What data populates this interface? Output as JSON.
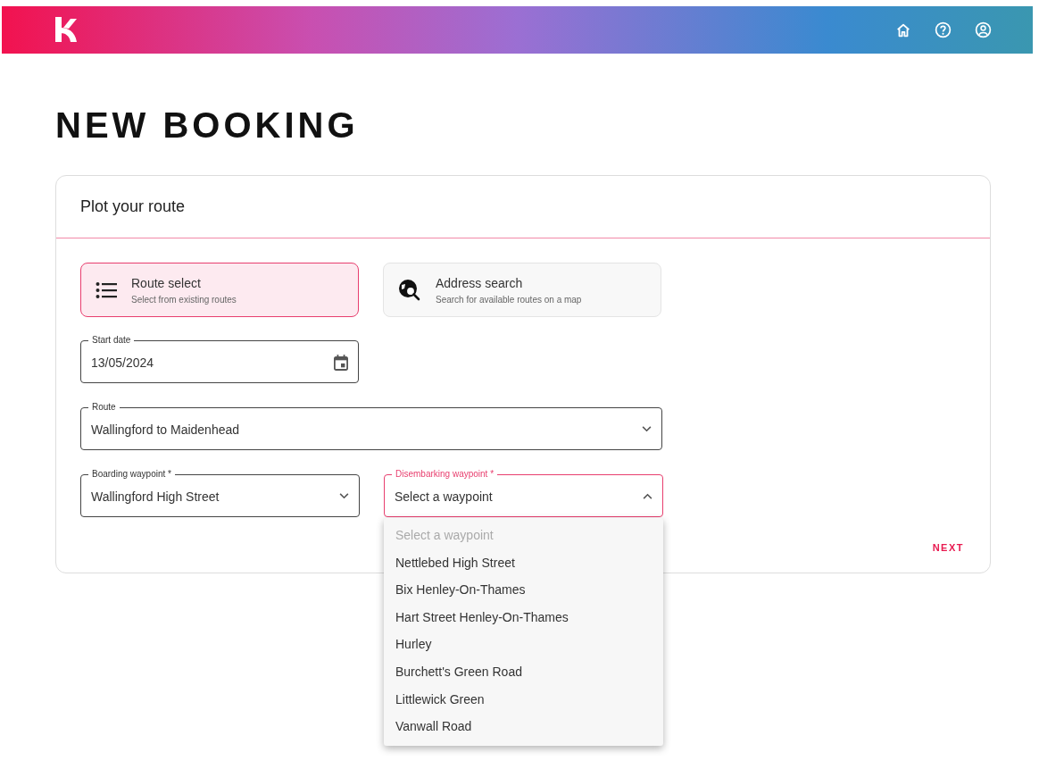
{
  "header": {
    "nav": [
      {
        "kind": "home"
      },
      {
        "kind": "help"
      },
      {
        "kind": "account"
      }
    ]
  },
  "title": "NEW BOOKING",
  "card": {
    "title": "Plot your route",
    "modes": [
      {
        "kind": "list",
        "label": "Route select",
        "description": "Select from existing routes",
        "selected": true
      },
      {
        "kind": "search",
        "label": "Address search",
        "description": "Search for available routes on a map",
        "selected": false
      }
    ],
    "start_date": {
      "label": "Start date",
      "value": "13/05/2024"
    },
    "route": {
      "label": "Route",
      "value": "Wallingford to Maidenhead",
      "open": false
    },
    "boarding": {
      "label": "Boarding waypoint *",
      "value": "Wallingford High Street",
      "open": false
    },
    "disembarking": {
      "label": "Disembarking waypoint *",
      "value": "Select a waypoint",
      "open": true
    },
    "next_button": "NEXT"
  },
  "dropdown": {
    "options": [
      {
        "label": "Select a waypoint",
        "disabled": true
      },
      {
        "label": "Nettlebed High Street",
        "disabled": false
      },
      {
        "label": "Bix Henley-On-Thames",
        "disabled": false
      },
      {
        "label": "Hart Street Henley-On-Thames",
        "disabled": false
      },
      {
        "label": "Hurley",
        "disabled": false
      },
      {
        "label": "Burchett's Green Road",
        "disabled": false
      },
      {
        "label": "Littlewick Green",
        "disabled": false
      },
      {
        "label": "Vanwall Road",
        "disabled": false
      }
    ]
  }
}
